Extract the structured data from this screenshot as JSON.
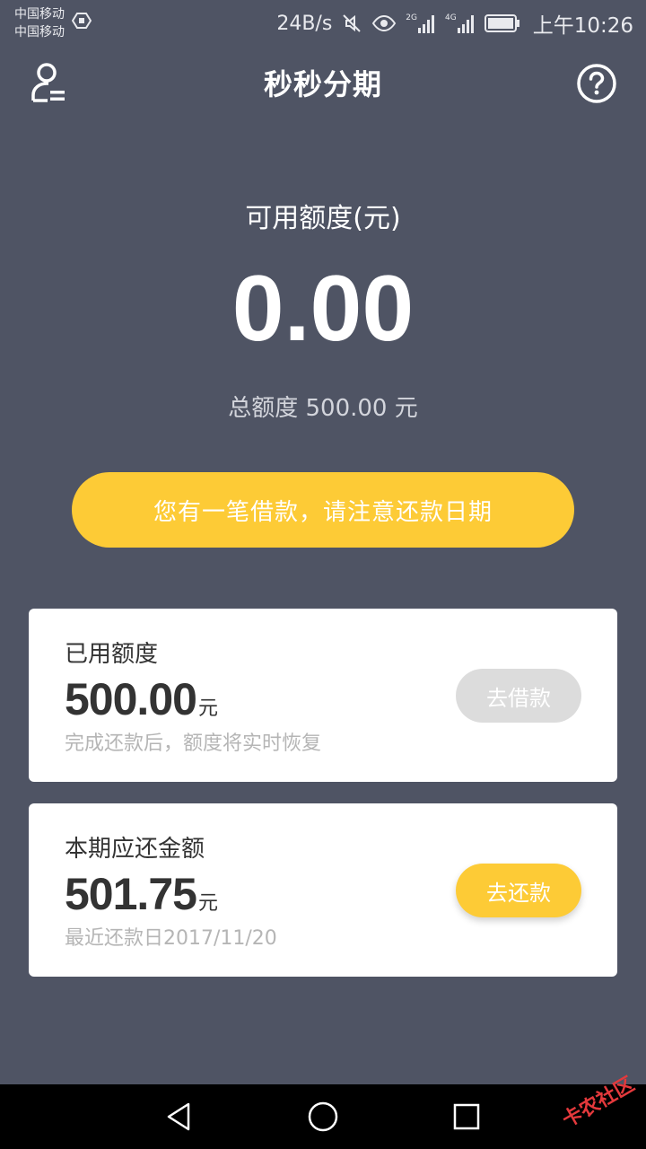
{
  "status_bar": {
    "carrier_1": "中国移动",
    "carrier_2": "中国移动",
    "net_speed": "24B/s",
    "signal_1_label": "2G",
    "signal_2_label": "4G",
    "time": "上午10:26",
    "icons": [
      "notification-badge-icon",
      "mute-icon",
      "eye-comfort-icon",
      "signal-2g-icon",
      "signal-4g-icon",
      "battery-icon"
    ]
  },
  "header": {
    "title": "秒秒分期",
    "left_icon": "user-profile-icon",
    "right_icon": "help-icon"
  },
  "credit": {
    "available_label": "可用额度(元)",
    "available_amount": "0.00",
    "total_line": "总额度 500.00 元"
  },
  "notice": {
    "label": "您有一笔借款，请注意还款日期"
  },
  "used_card": {
    "label": "已用额度",
    "amount": "500.00",
    "unit": "元",
    "hint": "完成还款后，额度将实时恢复",
    "action_label": "去借款"
  },
  "due_card": {
    "label": "本期应还金额",
    "amount": "501.75",
    "unit": "元",
    "hint": "最近还款日2017/11/20",
    "action_label": "去还款"
  },
  "nav_bar": {
    "icons": [
      "back-icon",
      "home-icon",
      "recent-apps-icon"
    ]
  },
  "watermark": {
    "text": "卡农社区"
  },
  "colors": {
    "background": "#4f5464",
    "accent": "#fdcb36",
    "card": "#ffffff",
    "disabled_button": "#dcdcdc"
  }
}
